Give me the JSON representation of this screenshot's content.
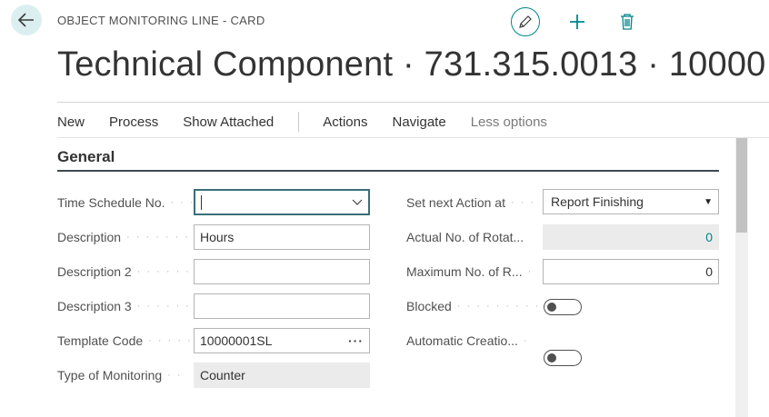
{
  "header": {
    "caption": "OBJECT MONITORING LINE - CARD",
    "title": "Technical Component · 731.315.0013 · 10000"
  },
  "actions": {
    "new": "New",
    "process": "Process",
    "show_attached": "Show Attached",
    "actions": "Actions",
    "navigate": "Navigate",
    "less_options": "Less options"
  },
  "general": {
    "title": "General",
    "time_schedule_no": {
      "label": "Time Schedule No.",
      "value": ""
    },
    "description": {
      "label": "Description",
      "value": "Hours"
    },
    "description2": {
      "label": "Description 2",
      "value": ""
    },
    "description3": {
      "label": "Description 3",
      "value": ""
    },
    "template_code": {
      "label": "Template Code",
      "value": "10000001SL"
    },
    "type_of_monitoring": {
      "label": "Type of Monitoring",
      "value": "Counter"
    },
    "set_next_action_at": {
      "label": "Set next Action at",
      "value": "Report Finishing"
    },
    "actual_no_rotations": {
      "label": "Actual No. of Rotat...",
      "value": "0"
    },
    "maximum_no": {
      "label": "Maximum No. of R...",
      "value": "0"
    },
    "blocked": {
      "label": "Blocked",
      "value": false
    },
    "automatic_creation": {
      "label": "Automatic Creatio...",
      "value": false
    }
  },
  "colors": {
    "accent": "#00868b",
    "back_bg": "#dbeff0"
  }
}
